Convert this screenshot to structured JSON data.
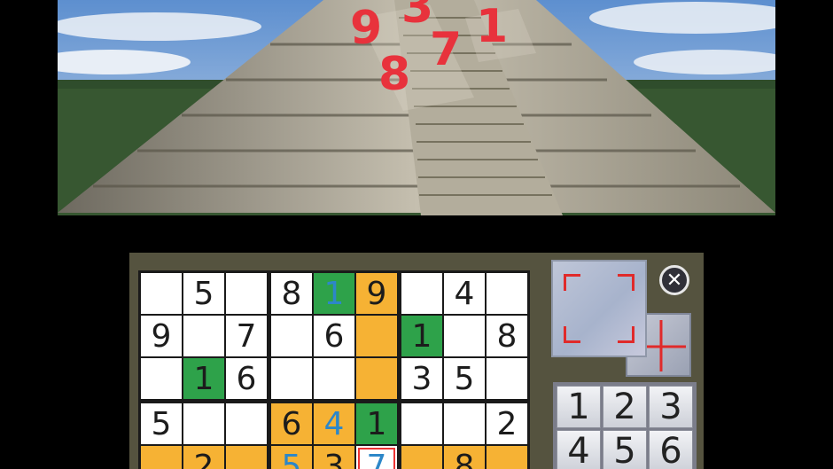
{
  "top_screen": {
    "floating_digits": [
      "9",
      "3",
      "1",
      "7",
      "8"
    ]
  },
  "puzzle": {
    "rows": [
      [
        "",
        "5",
        "",
        "8",
        "1",
        "9",
        "",
        "4",
        ""
      ],
      [
        "9",
        "",
        "7",
        "",
        "6",
        "",
        "1",
        "",
        "8"
      ],
      [
        "",
        "1",
        "6",
        "",
        "",
        "",
        "3",
        "5",
        ""
      ],
      [
        "5",
        "",
        "",
        "6",
        "4",
        "1",
        "",
        "",
        "2"
      ],
      [
        "",
        "2",
        "",
        "5",
        "3",
        "7",
        "",
        "8",
        ""
      ]
    ],
    "green_cells": [
      [
        0,
        4
      ],
      [
        1,
        6
      ],
      [
        2,
        1
      ],
      [
        3,
        5
      ]
    ],
    "highlight_cells": [
      [
        0,
        5
      ],
      [
        1,
        5
      ],
      [
        2,
        5
      ],
      [
        3,
        3
      ],
      [
        3,
        4
      ],
      [
        3,
        5
      ],
      [
        4,
        0
      ],
      [
        4,
        1
      ],
      [
        4,
        2
      ],
      [
        4,
        3
      ],
      [
        4,
        4
      ],
      [
        4,
        6
      ],
      [
        4,
        7
      ],
      [
        4,
        8
      ]
    ],
    "blue_digit_cells": [
      [
        0,
        4
      ],
      [
        3,
        4
      ],
      [
        4,
        3
      ],
      [
        4,
        5
      ]
    ],
    "cursor_cell": [
      4,
      5
    ]
  },
  "controls": {
    "close_symbol": "✕",
    "number_keys": [
      "1",
      "2",
      "3",
      "4",
      "5",
      "6"
    ]
  },
  "colors": {
    "highlight": "#f6b234",
    "given_green": "#2ea24a",
    "entered_blue": "#2d87c8",
    "top_digits": "#e8323c"
  }
}
